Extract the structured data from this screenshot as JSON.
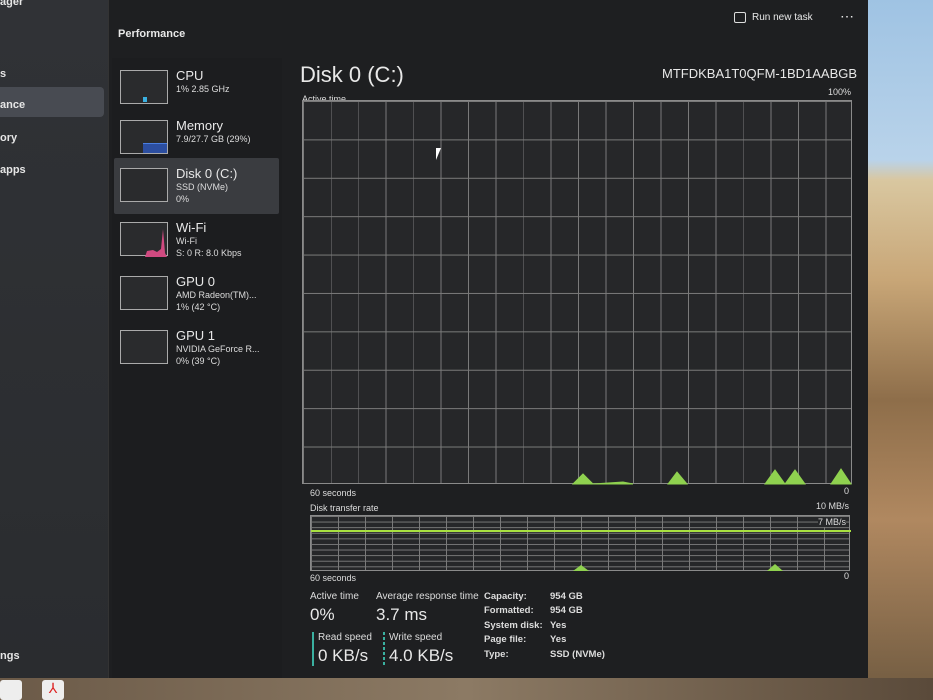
{
  "header": {
    "title": "Performance",
    "run_new_task": "Run new task",
    "more": "⋯"
  },
  "nav": {
    "items": [
      "ager",
      "s",
      "ance",
      "ory",
      "apps",
      "ngs"
    ]
  },
  "devices": [
    {
      "name": "CPU",
      "line1": "1% 2.85 GHz",
      "line2": ""
    },
    {
      "name": "Memory",
      "line1": "7.9/27.7 GB (29%)",
      "line2": ""
    },
    {
      "name": "Disk 0 (C:)",
      "line1": "SSD (NVMe)",
      "line2": "0%"
    },
    {
      "name": "Wi-Fi",
      "line1": "Wi-Fi",
      "line2": "S: 0 R: 8.0 Kbps"
    },
    {
      "name": "GPU 0",
      "line1": "AMD Radeon(TM)...",
      "line2": "1% (42 °C)"
    },
    {
      "name": "GPU 1",
      "line1": "NVIDIA GeForce R...",
      "line2": "0% (39 °C)"
    }
  ],
  "disk": {
    "title": "Disk 0 (C:)",
    "model": "MTFDKBA1T0QFM-1BD1AABGB",
    "active_label": "Active time",
    "active_max": "100%",
    "seconds": "60 seconds",
    "zero": "0",
    "rate_label": "Disk transfer rate",
    "rate_max": "10 MB/s",
    "rate_line": "7 MB/s",
    "stats": {
      "active_time_label": "Active time",
      "active_time": "0%",
      "resp_label": "Average response time",
      "resp": "3.7 ms",
      "read_label": "Read speed",
      "read": "0 KB/s",
      "write_label": "Write speed",
      "write": "4.0 KB/s"
    },
    "props": [
      [
        "Capacity:",
        "954 GB"
      ],
      [
        "Formatted:",
        "954 GB"
      ],
      [
        "System disk:",
        "Yes"
      ],
      [
        "Page file:",
        "Yes"
      ],
      [
        "Type:",
        "SSD (NVMe)"
      ]
    ]
  },
  "colors": {
    "disk": "#8fd14f"
  }
}
